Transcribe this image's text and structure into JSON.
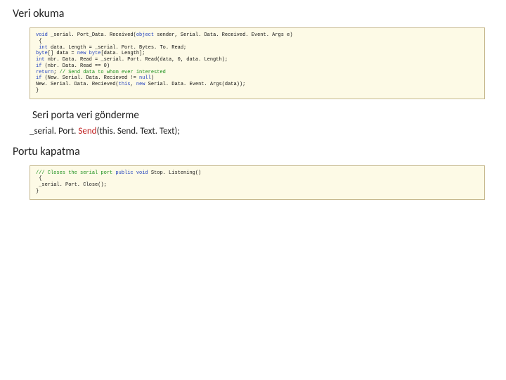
{
  "headings": {
    "read": "Veri okuma",
    "send": "Seri porta veri gönderme",
    "close": "Portu kapatma"
  },
  "api_line": {
    "prefix": "_serial. Port. ",
    "method": "Send",
    "suffix": "(this. Send. Text. Text);"
  },
  "code1": {
    "l1a": "void",
    "l1b": " _serial. Port_Data. Received(",
    "l1c": "object",
    "l1d": " sender, Serial. Data. Received. Event. Args e)",
    "l2": " {",
    "l3a": " int",
    "l3b": " data. Length = _serial. Port. Bytes. To. Read;",
    "l4a": "byte",
    "l4b": "[] data = ",
    "l4c": "new byte",
    "l4d": "[data. Length];",
    "l5a": "int",
    "l5b": " nbr. Data. Read = _serial. Port. Read(data, 0, data. Length);",
    "l6a": "if",
    "l6b": " (nbr. Data. Read == 0)",
    "l7a": "return",
    "l7b": "; ",
    "l7c": "// Send data to whom ever interested",
    "l8a": "if",
    "l8b": " (New. Serial. Data. Recieved != ",
    "l8c": "null",
    "l8d": ")",
    "l9a": "New. Serial. Data. Recieved(",
    "l9b": "this",
    "l9c": ", ",
    "l9d": "new",
    "l9e": " Serial. Data. Event. Args(data));",
    "l10": "}"
  },
  "code2": {
    "l1a": "/// Closes the serial port",
    "l1b": " public void",
    "l1c": " Stop. Listening()",
    "l2": " {",
    "l3": " _serial. Port. Close();",
    "l4": "}"
  }
}
